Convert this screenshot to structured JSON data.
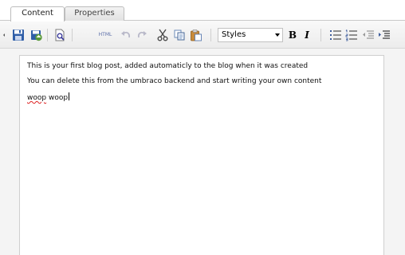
{
  "tabs": [
    {
      "label": "Content",
      "active": true
    },
    {
      "label": "Properties",
      "active": false
    }
  ],
  "toolbar": {
    "buttons": [
      {
        "name": "toolbar-handle-icon"
      },
      {
        "name": "save-icon"
      },
      {
        "name": "save-and-publish-icon"
      },
      {
        "name": "preview-icon"
      },
      {
        "name": "undo-icon"
      },
      {
        "name": "redo-icon"
      },
      {
        "name": "cut-icon"
      },
      {
        "name": "copy-icon"
      },
      {
        "name": "paste-icon"
      },
      {
        "name": "bullet-list-icon"
      },
      {
        "name": "numbered-list-icon"
      },
      {
        "name": "outdent-icon"
      },
      {
        "name": "indent-icon"
      }
    ],
    "html_label": "HTML",
    "styles_value": "Styles",
    "bold_label": "B",
    "italic_label": "I"
  },
  "editor": {
    "line1": "This is your first blog post, added automaticly to the blog when it was created",
    "line2": "You can delete this from the umbraco backend and start writing your own content",
    "line3_misspelled": "woop",
    "line3_rest": " woop"
  },
  "colors": {
    "spellcheck_underline": "#dd2222",
    "tab_border": "#bdbdbd",
    "toolbar_bg": "#ececec"
  }
}
